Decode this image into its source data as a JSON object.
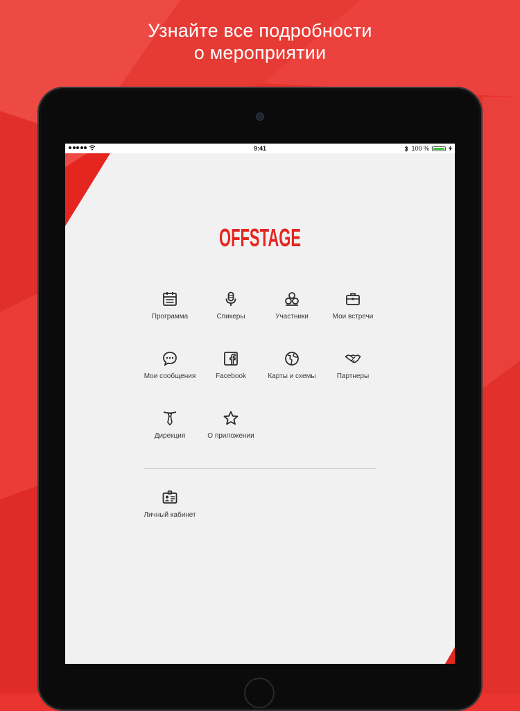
{
  "promo": {
    "headline_line1": "Узнайте все подробности",
    "headline_line2": "о мероприятии"
  },
  "status_bar": {
    "time": "9:41",
    "battery": "100 %",
    "battery_level": 1.0
  },
  "app": {
    "logo_text": "OFFSTAGE",
    "brand_color": "#e42520"
  },
  "menu": {
    "items": [
      {
        "label": "Программа",
        "icon": "calendar-icon"
      },
      {
        "label": "Спикеры",
        "icon": "microphone-icon"
      },
      {
        "label": "Участники",
        "icon": "participants-icon"
      },
      {
        "label": "Мои встречи",
        "icon": "briefcase-icon"
      },
      {
        "label": "Мои сообщения",
        "icon": "chat-bubble-icon"
      },
      {
        "label": "Facebook",
        "icon": "facebook-icon"
      },
      {
        "label": "Карты и схемы",
        "icon": "globe-map-icon"
      },
      {
        "label": "Партнеры",
        "icon": "handshake-icon"
      },
      {
        "label": "Дирекция",
        "icon": "tie-icon"
      },
      {
        "label": "О приложении",
        "icon": "star-icon"
      }
    ],
    "account": {
      "label": "Личный кабинет",
      "icon": "id-card-icon"
    }
  }
}
